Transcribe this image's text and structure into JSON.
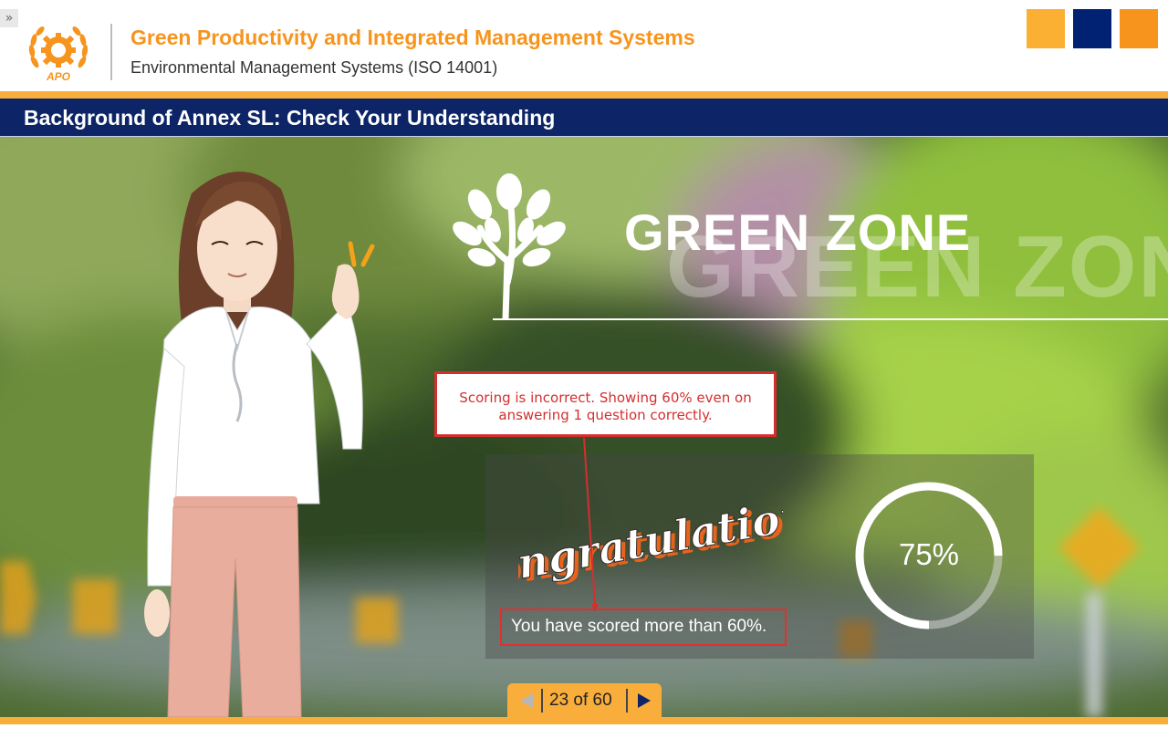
{
  "header": {
    "menu_toggle": "»",
    "course_title": "Green Productivity and Integrated Management Systems",
    "course_subtitle": "Environmental Management Systems (ISO 14001)",
    "logo_text": "APO",
    "brand_colors": [
      "#fbb034",
      "#012172",
      "#f7941d"
    ]
  },
  "slide_header": {
    "title": "Background of Annex SL: Check Your Understanding"
  },
  "slide": {
    "zone_title": "GREEN ZONE",
    "zone_title_shadow": "GREEN ZON",
    "callout": "Scoring is incorrect. Showing 60% even on answering 1 question correctly.",
    "congrats_text": "Congratulations",
    "score_message": "You have scored more than 60%.",
    "score_value": "75%",
    "score_fraction": 0.75
  },
  "nav": {
    "page_counter": "23 of 60",
    "prev_icon": "triangle-left-icon",
    "next_icon": "triangle-right-icon"
  },
  "colors": {
    "accent_orange": "#f9ae3c",
    "title_orange": "#f7941d",
    "navy": "#0d2566",
    "callout_red": "#d32f2f"
  }
}
